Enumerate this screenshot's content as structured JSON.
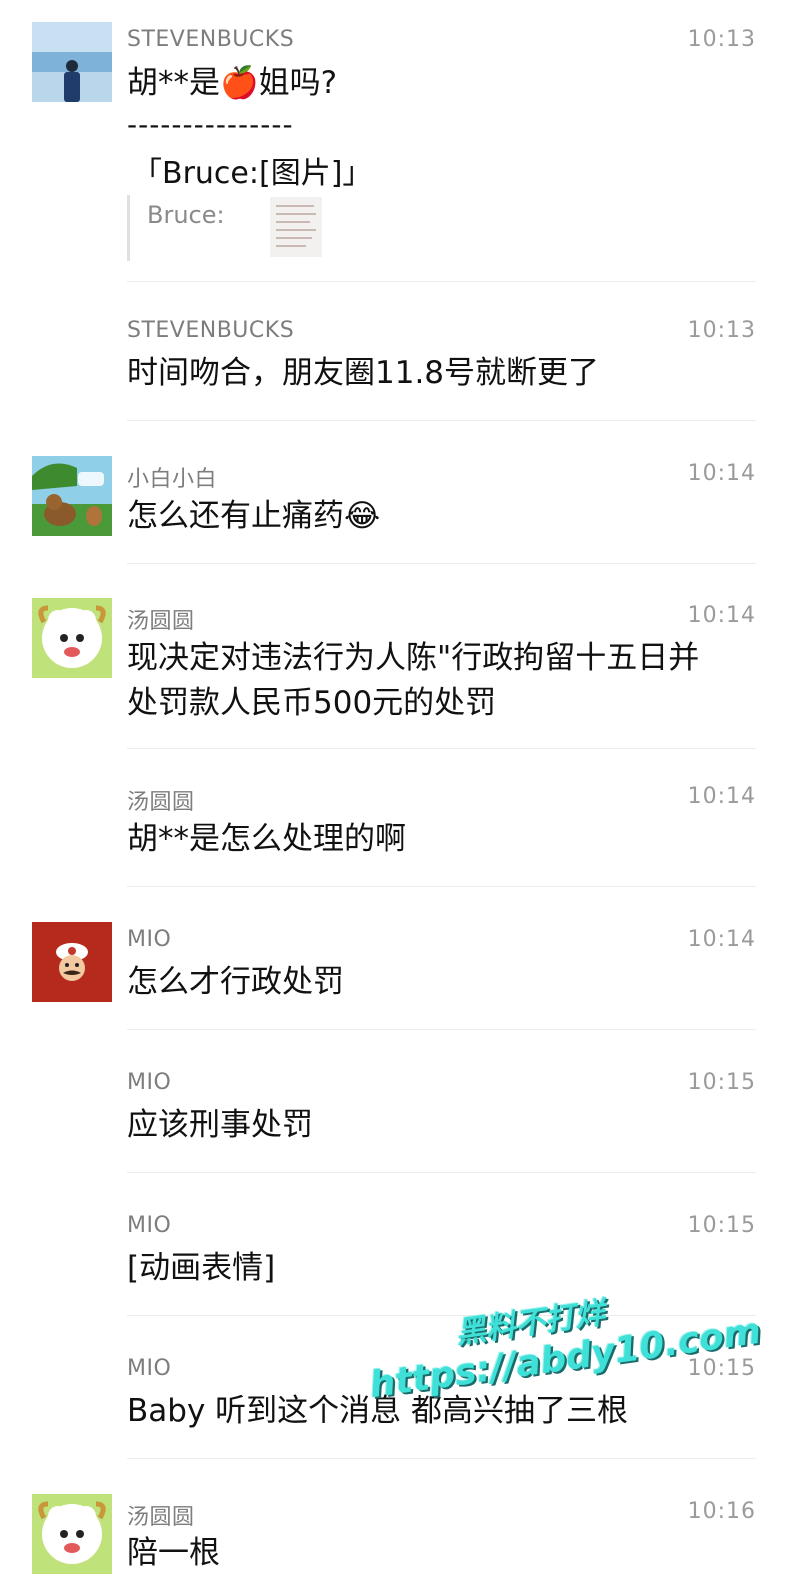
{
  "messages": [
    {
      "sender": "STEVENBUCKS",
      "time": "10:13",
      "lines": [
        "胡**是🍎姐吗?"
      ],
      "quote": {
        "dashes": "---------------",
        "ref": "「Bruce:[图片]」",
        "label": "Bruce:"
      }
    },
    {
      "sender": "STEVENBUCKS",
      "time": "10:13",
      "lines": [
        "时间吻合，朋友圈11.8号就断更了"
      ]
    },
    {
      "sender": "小白小白",
      "time": "10:14",
      "lines": [
        "怎么还有止痛药😂"
      ]
    },
    {
      "sender": "汤圆圆",
      "time": "10:14",
      "lines": [
        "现决定对违法行为人陈\"行政拘留十五日并",
        "处罚款人民币500元的处罚"
      ]
    },
    {
      "sender": "汤圆圆",
      "time": "10:14",
      "lines": [
        "胡**是怎么处理的啊"
      ]
    },
    {
      "sender": "MIO",
      "time": "10:14",
      "lines": [
        "怎么才行政处罚"
      ]
    },
    {
      "sender": "MIO",
      "time": "10:15",
      "lines": [
        "应该刑事处罚"
      ]
    },
    {
      "sender": "MIO",
      "time": "10:15",
      "lines": [
        "[动画表情]"
      ]
    },
    {
      "sender": "MIO",
      "time": "10:15",
      "lines": [
        "Baby 听到这个消息 都高兴抽了三根"
      ]
    },
    {
      "sender": "汤圆圆",
      "time": "10:16",
      "lines": [
        "陪一根"
      ]
    }
  ],
  "watermark": {
    "line1": "黑料不打烊",
    "line2": "https://abdy10.com"
  },
  "avatars": {
    "steven": "person-beach-avatar",
    "xiaobai": "cartoon-bear-avatar",
    "tangyuan": "pleasant-goat-avatar",
    "mio": "mario-avatar"
  }
}
